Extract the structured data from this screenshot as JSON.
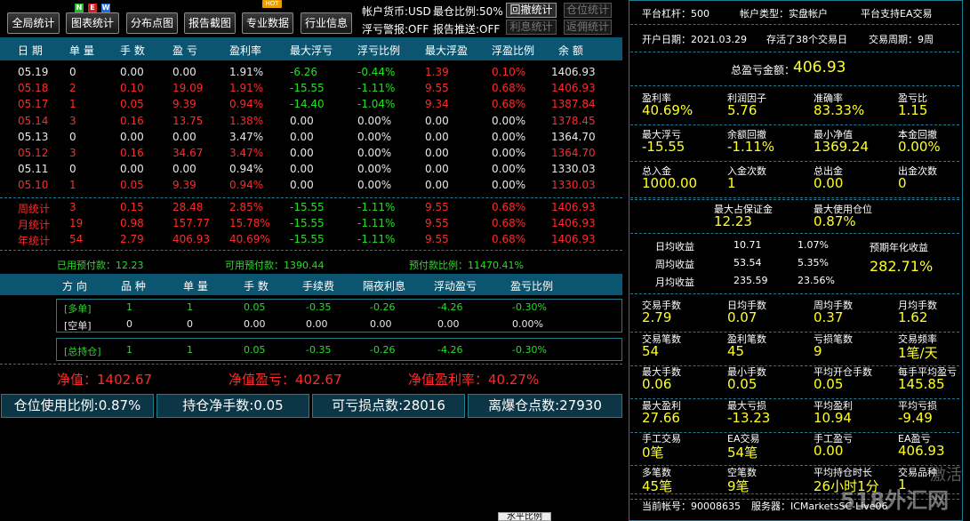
{
  "toolbar": {
    "buttons": [
      "全局统计",
      "图表统计",
      "分布点图",
      "报告截图",
      "专业数据",
      "行业信息"
    ],
    "new_badge": [
      "N",
      "E",
      "W"
    ],
    "hot_badge": "HOT",
    "currency": "帐户货币:USD",
    "max_pos_ratio": "最仓比例:50%",
    "float_loss_alert": "浮亏警报:OFF",
    "report_push": "报告推送:OFF",
    "drawdown_btn": "回撤统计",
    "position_btn": "仓位统计",
    "interest_btn": "利息统计",
    "return_btn": "返佣统计"
  },
  "daily_table": {
    "headers": [
      "日 期",
      "单 量",
      "手 数",
      "盈 亏",
      "盈利率",
      "最大浮亏",
      "浮亏比例",
      "最大浮盈",
      "浮盈比例",
      "余 额"
    ],
    "rows": [
      {
        "date": "05.19",
        "orders": "0",
        "lots": "0.00",
        "pnl": "0.00",
        "rate": "1.91%",
        "max_float_loss": "-6.26",
        "float_loss_ratio": "-0.44%",
        "max_float_profit": "1.39",
        "float_profit_ratio": "0.10%",
        "balance": "1406.93",
        "tone": "w"
      },
      {
        "date": "05.18",
        "orders": "2",
        "lots": "0.10",
        "pnl": "19.09",
        "rate": "1.91%",
        "max_float_loss": "-15.55",
        "float_loss_ratio": "-1.11%",
        "max_float_profit": "9.55",
        "float_profit_ratio": "0.68%",
        "balance": "1406.93",
        "tone": "r"
      },
      {
        "date": "05.17",
        "orders": "1",
        "lots": "0.05",
        "pnl": "9.39",
        "rate": "0.94%",
        "max_float_loss": "-14.40",
        "float_loss_ratio": "-1.04%",
        "max_float_profit": "9.34",
        "float_profit_ratio": "0.68%",
        "balance": "1387.84",
        "tone": "r"
      },
      {
        "date": "05.14",
        "orders": "3",
        "lots": "0.16",
        "pnl": "13.75",
        "rate": "1.38%",
        "max_float_loss": "0.00",
        "float_loss_ratio": "0.00%",
        "max_float_profit": "0.00",
        "float_profit_ratio": "0.00%",
        "balance": "1378.45",
        "tone": "r"
      },
      {
        "date": "05.13",
        "orders": "0",
        "lots": "0.00",
        "pnl": "0.00",
        "rate": "3.47%",
        "max_float_loss": "0.00",
        "float_loss_ratio": "0.00%",
        "max_float_profit": "0.00",
        "float_profit_ratio": "0.00%",
        "balance": "1364.70",
        "tone": "w"
      },
      {
        "date": "05.12",
        "orders": "3",
        "lots": "0.16",
        "pnl": "34.67",
        "rate": "3.47%",
        "max_float_loss": "0.00",
        "float_loss_ratio": "0.00%",
        "max_float_profit": "0.00",
        "float_profit_ratio": "0.00%",
        "balance": "1364.70",
        "tone": "r"
      },
      {
        "date": "05.11",
        "orders": "0",
        "lots": "0.00",
        "pnl": "0.00",
        "rate": "0.94%",
        "max_float_loss": "0.00",
        "float_loss_ratio": "0.00%",
        "max_float_profit": "0.00",
        "float_profit_ratio": "0.00%",
        "balance": "1330.03",
        "tone": "w"
      },
      {
        "date": "05.10",
        "orders": "1",
        "lots": "0.05",
        "pnl": "9.39",
        "rate": "0.94%",
        "max_float_loss": "0.00",
        "float_loss_ratio": "0.00%",
        "max_float_profit": "0.00",
        "float_profit_ratio": "0.00%",
        "balance": "1330.03",
        "tone": "r"
      }
    ],
    "summary": [
      {
        "label": "周统计",
        "orders": "3",
        "lots": "0.15",
        "pnl": "28.48",
        "rate": "2.85%",
        "max_float_loss": "-15.55",
        "float_loss_ratio": "-1.11%",
        "max_float_profit": "9.55",
        "float_profit_ratio": "0.68%",
        "balance": "1406.93"
      },
      {
        "label": "月统计",
        "orders": "19",
        "lots": "0.98",
        "pnl": "157.77",
        "rate": "15.78%",
        "max_float_loss": "-15.55",
        "float_loss_ratio": "-1.11%",
        "max_float_profit": "9.55",
        "float_profit_ratio": "0.68%",
        "balance": "1406.93"
      },
      {
        "label": "年统计",
        "orders": "54",
        "lots": "2.79",
        "pnl": "406.93",
        "rate": "40.69%",
        "max_float_loss": "-15.55",
        "float_loss_ratio": "-1.11%",
        "max_float_profit": "9.55",
        "float_profit_ratio": "0.68%",
        "balance": "1406.93"
      }
    ],
    "margin": {
      "used": "已用预付款：12.23",
      "available": "可用预付款：1390.44",
      "ratio": "预付款比例：11470.41%"
    }
  },
  "position_table": {
    "headers": [
      "方 向",
      "品 种",
      "单 量",
      "手 数",
      "手续费",
      "隔夜利息",
      "浮动盈亏",
      "盈亏比例"
    ],
    "rows": [
      {
        "dir": "[多单]",
        "symbols": "1",
        "orders": "1",
        "lots": "0.05",
        "fee": "-0.35",
        "swap": "-0.26",
        "float_pnl": "-4.26",
        "ratio": "-0.30%",
        "tone": "g"
      },
      {
        "dir": "[空单]",
        "symbols": "0",
        "orders": "0",
        "lots": "0.00",
        "fee": "0.00",
        "swap": "0.00",
        "float_pnl": "0.00",
        "ratio": "0.00%",
        "tone": "w"
      }
    ],
    "total": {
      "dir": "[总持仓]",
      "symbols": "1",
      "orders": "1",
      "lots": "0.05",
      "fee": "-0.35",
      "swap": "-0.26",
      "float_pnl": "-4.26",
      "ratio": "-0.30%"
    },
    "equity": "净值：1402.67",
    "equity_pnl": "净值盈亏：402.67",
    "equity_rate": "净值盈利率：40.27%"
  },
  "footer_buttons": [
    "仓位使用比例:0.87%",
    "持仓净手数:0.05",
    "可亏损点数:28016",
    "离爆仓点数:27930"
  ],
  "right_panel": {
    "top": {
      "leverage": "平台杠杆：500",
      "account_type": "帐户类型：实盘帐户",
      "ea_support": "平台支持EA交易",
      "open_date": "开户日期：2021.03.29",
      "alive": "存活了38个交易日",
      "period": "交易周期：9周"
    },
    "total_pnl_label": "总盈亏金额：",
    "total_pnl": "406.93",
    "stats": [
      [
        {
          "l": "盈利率",
          "v": "40.69%"
        },
        {
          "l": "利润因子",
          "v": "5.76"
        },
        {
          "l": "准确率",
          "v": "83.33%"
        },
        {
          "l": "盈亏比",
          "v": "1.15"
        }
      ],
      [
        {
          "l": "最大浮亏",
          "v": "-15.55"
        },
        {
          "l": "余额回撤",
          "v": "-1.11%"
        },
        {
          "l": "最小净值",
          "v": "1369.24"
        },
        {
          "l": "本金回撤",
          "v": "0.00%"
        }
      ],
      [
        {
          "l": "总入金",
          "v": "1000.00"
        },
        {
          "l": "入金次数",
          "v": "1"
        },
        {
          "l": "总出金",
          "v": "0.00"
        },
        {
          "l": "出金次数",
          "v": "0"
        }
      ]
    ],
    "margin_stats": [
      {
        "l": "最大占保证金",
        "v": "12.23"
      },
      {
        "l": "最大使用仓位",
        "v": "0.87%"
      }
    ],
    "returns": [
      {
        "l": "日均收益",
        "v": "10.71",
        "p": "1.07%"
      },
      {
        "l": "周均收益",
        "v": "53.54",
        "p": "5.35%"
      },
      {
        "l": "月均收益",
        "v": "235.59",
        "p": "23.56%"
      }
    ],
    "annual_label": "预期年化收益",
    "annual_value": "282.71%",
    "stats2": [
      [
        {
          "l": "交易手数",
          "v": "2.79"
        },
        {
          "l": "日均手数",
          "v": "0.07"
        },
        {
          "l": "周均手数",
          "v": "0.37"
        },
        {
          "l": "月均手数",
          "v": "1.62"
        }
      ],
      [
        {
          "l": "交易笔数",
          "v": "54"
        },
        {
          "l": "盈利笔数",
          "v": "45"
        },
        {
          "l": "亏损笔数",
          "v": "9"
        },
        {
          "l": "交易频率",
          "v": "1笔/天"
        }
      ],
      [
        {
          "l": "最大手数",
          "v": "0.06"
        },
        {
          "l": "最小手数",
          "v": "0.05"
        },
        {
          "l": "平均开仓手数",
          "v": "0.05"
        },
        {
          "l": "每手平均盈亏",
          "v": "145.85"
        }
      ],
      [
        {
          "l": "最大盈利",
          "v": "27.66"
        },
        {
          "l": "最大亏损",
          "v": "-13.23"
        },
        {
          "l": "平均盈利",
          "v": "10.94"
        },
        {
          "l": "平均亏损",
          "v": "-9.49"
        }
      ],
      [
        {
          "l": "手工交易",
          "v": "0笔"
        },
        {
          "l": "EA交易",
          "v": "54笔"
        },
        {
          "l": "手工盈亏",
          "v": "0.00"
        },
        {
          "l": "EA盈亏",
          "v": "406.93"
        }
      ],
      [
        {
          "l": "多笔数",
          "v": "45笔"
        },
        {
          "l": "空笔数",
          "v": "9笔"
        },
        {
          "l": "平均持仓时长",
          "v": "26小时1分"
        },
        {
          "l": "交易品种",
          "v": "1"
        }
      ]
    ],
    "account_no": "当前帐号：90008635",
    "server": "服务器：ICMarketsSC-Live06"
  },
  "watermark": "518外汇网",
  "watermark_side": "激活",
  "tooltip_stub": "水平比例"
}
